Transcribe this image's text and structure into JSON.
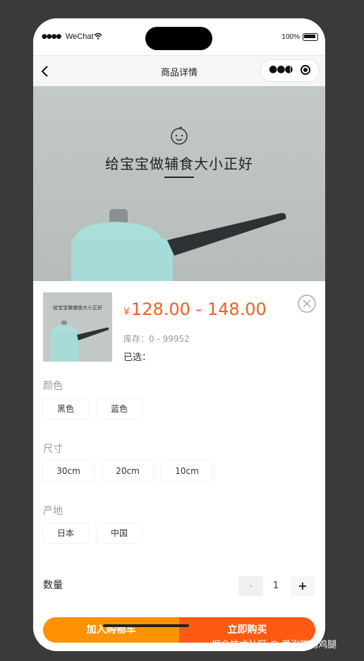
{
  "status_bar": {
    "carrier": "WeChat",
    "battery_percent": "100%",
    "signal_icon": "signal-dots-icon",
    "wifi_icon": "wifi-icon",
    "battery_icon": "battery-icon"
  },
  "nav": {
    "title": "商品详情",
    "back_icon": "chevron-left-icon",
    "more_icon": "more-dots-icon",
    "close_icon": "target-circle-icon"
  },
  "hero": {
    "caption": "给宝宝做辅食大小正好"
  },
  "sku": {
    "currency": "¥",
    "price_range": "128.00 - 148.00",
    "stock": "库存：0 - 99952",
    "selected": "已选：",
    "thumbnail_caption": "给宝宝做辅食大小正好",
    "groups": [
      {
        "label": "颜色",
        "options": [
          "黑色",
          "蓝色"
        ]
      },
      {
        "label": "尺寸",
        "options": [
          "30cm",
          "20cm",
          "10cm"
        ]
      },
      {
        "label": "产地",
        "options": [
          "日本",
          "中国"
        ]
      }
    ],
    "quantity_label": "数量",
    "quantity_minus": "-",
    "quantity_value": "1",
    "quantity_plus": "+"
  },
  "actions": {
    "add_to_cart": "加入购物车",
    "buy_now": "立即购买"
  },
  "watermark": "掘金技术社区 @ 爱泡脚的鸡腿",
  "colors": {
    "price": "#f0601f",
    "cart_button": "#ff9200",
    "buy_button": "#ff5a12"
  }
}
